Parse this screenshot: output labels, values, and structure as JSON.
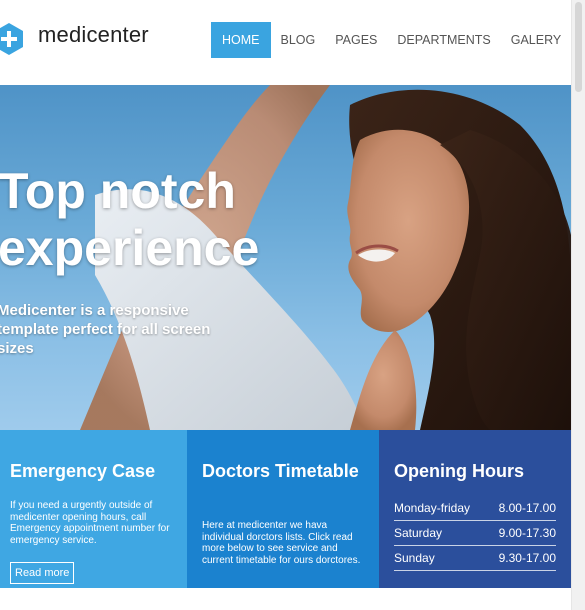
{
  "brand": {
    "name": "medicenter"
  },
  "nav": [
    {
      "label": "HOME",
      "active": true
    },
    {
      "label": "BLOG",
      "active": false
    },
    {
      "label": "PAGES",
      "active": false
    },
    {
      "label": "DEPARTMENTS",
      "active": false
    },
    {
      "label": "GALERY",
      "active": false
    }
  ],
  "hero": {
    "title": "Top notch experience",
    "subtitle": "Medicenter is a responsive template perfect for all screen sizes"
  },
  "boxes": {
    "emergency": {
      "title": "Emergency Case",
      "text": "If you need a urgently outside of medicenter opening hours, call Emergency appointment number for emergency service.",
      "button": "Read more"
    },
    "doctors": {
      "title": "Doctors Timetable",
      "text": "Here at medicenter we hava individual dorctors lists. Click read more below to see service and current timetable for ours dorctores."
    },
    "hours": {
      "title": "Opening Hours",
      "rows": [
        {
          "day": "Monday-friday",
          "time": "8.00-17.00"
        },
        {
          "day": "Saturday",
          "time": "9.00-17.30"
        },
        {
          "day": "Sunday",
          "time": "9.30-17.00"
        }
      ]
    }
  },
  "colors": {
    "accent": "#3aa4e0",
    "box_light": "#3fa7e3",
    "box_mid": "#1b82cf",
    "box_dark": "#2b4f9c"
  },
  "icons": {
    "logo": "medical-cross-hexagon-icon"
  }
}
